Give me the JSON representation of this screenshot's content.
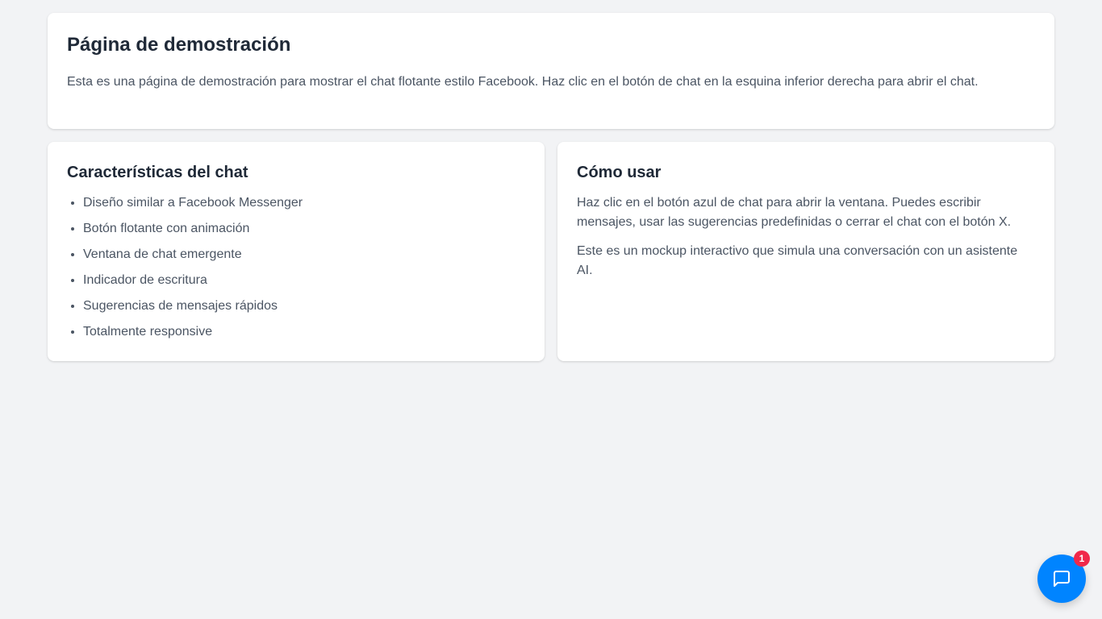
{
  "hero": {
    "title": "Página de demostración",
    "description": "Esta es una página de demostración para mostrar el chat flotante estilo Facebook. Haz clic en el botón de chat en la esquina inferior derecha para abrir el chat."
  },
  "features": {
    "title": "Características del chat",
    "items": [
      "Diseño similar a Facebook Messenger",
      "Botón flotante con animación",
      "Ventana de chat emergente",
      "Indicador de escritura",
      "Sugerencias de mensajes rápidos",
      "Totalmente responsive"
    ]
  },
  "usage": {
    "title": "Cómo usar",
    "paragraphs": [
      "Haz clic en el botón azul de chat para abrir la ventana. Puedes escribir mensajes, usar las sugerencias predefinidas o cerrar el chat con el botón X.",
      "Este es un mockup interactivo que simula una conversación con un asistente AI."
    ]
  },
  "chat_button": {
    "icon": "chat-bubble-icon",
    "badge_count": "1",
    "color": "#0084ff",
    "badge_color": "#f02849"
  }
}
